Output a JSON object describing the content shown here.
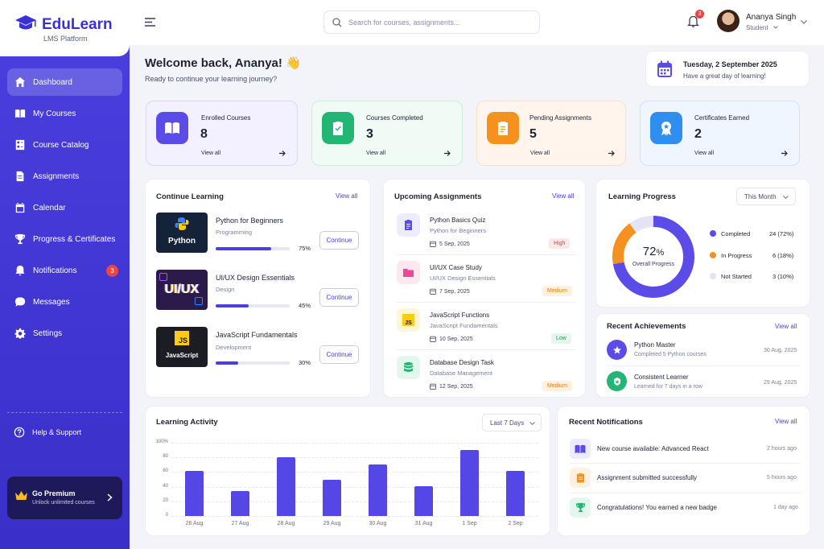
{
  "brand": {
    "name": "EduLearn",
    "sub": "LMS Platform"
  },
  "sidebar": {
    "items": [
      {
        "label": "Dashboard"
      },
      {
        "label": "My Courses"
      },
      {
        "label": "Course Catalog"
      },
      {
        "label": "Assignments"
      },
      {
        "label": "Calendar"
      },
      {
        "label": "Progress & Certificates"
      },
      {
        "label": "Notifications",
        "badge": "3"
      },
      {
        "label": "Messages"
      },
      {
        "label": "Settings"
      }
    ],
    "help": "Help & Support",
    "premium": {
      "title": "Go Premium",
      "sub": "Unlock unlimited courses"
    }
  },
  "topbar": {
    "search_placeholder": "Search for courses, assignments...",
    "notif_count": "3",
    "user_name": "Ananya Singh",
    "user_role": "Student"
  },
  "welcome": {
    "title": "Welcome back, Ananya! 👋",
    "sub": "Ready to continue your learning journey?"
  },
  "date": {
    "date": "Tuesday, 2 September 2025",
    "sub": "Have a great day of learning!"
  },
  "stats": [
    {
      "label": "Enrolled Courses",
      "value": "8",
      "link": "View all",
      "color": "#5b4ce8"
    },
    {
      "label": "Courses Completed",
      "value": "3",
      "link": "View all",
      "color": "#22b573"
    },
    {
      "label": "Pending Assignments",
      "value": "5",
      "link": "View all",
      "color": "#f5911e"
    },
    {
      "label": "Certificates Earned",
      "value": "2",
      "link": "View all",
      "color": "#2f8ff0"
    }
  ],
  "continue": {
    "title": "Continue Learning",
    "link": "View all",
    "courses": [
      {
        "name": "Python for Beginners",
        "cat": "Programming",
        "pct": "75%",
        "progress": 0.75,
        "thumb": "Python",
        "btn": "Continue"
      },
      {
        "name": "UI/UX Design Essentials",
        "cat": "Design",
        "pct": "45%",
        "progress": 0.45,
        "thumb": "UI/UX",
        "btn": "Continue"
      },
      {
        "name": "JavaScript Fundamentals",
        "cat": "Development",
        "pct": "30%",
        "progress": 0.3,
        "thumb": "JavaScript",
        "thumb_icon": "JS",
        "btn": "Continue"
      }
    ]
  },
  "assignments": {
    "title": "Upcoming Assignments",
    "link": "View all",
    "items": [
      {
        "name": "Python Basics Quiz",
        "course": "Python for Beginners",
        "date": "5 Sep, 2025",
        "priority": "High"
      },
      {
        "name": "UI/UX Case Study",
        "course": "UI/UX Design Essentials",
        "date": "7 Sep, 2025",
        "priority": "Medium"
      },
      {
        "name": "JavaScript Functions",
        "course": "JavaScript Fundamentals",
        "date": "10 Sep, 2025",
        "priority": "Low",
        "icon_text": "JS"
      },
      {
        "name": "Database Design Task",
        "course": "Database Management",
        "date": "12 Sep, 2025",
        "priority": "Medium"
      }
    ]
  },
  "progress": {
    "title": "Learning Progress",
    "filter": "This Month",
    "center_value": "72",
    "center_pct": "%",
    "center_label": "Overall Progress",
    "legend": [
      {
        "label": "Completed",
        "value": "24 (72%)",
        "color": "#5b4ce8",
        "fraction": 0.72
      },
      {
        "label": "In Progress",
        "value": "6 (18%)",
        "color": "#f5911e",
        "fraction": 0.18
      },
      {
        "label": "Not Started",
        "value": "3 (10%)",
        "color": "#e4e3f7",
        "fraction": 0.1
      }
    ]
  },
  "achievements": {
    "title": "Recent Achievements",
    "link": "View all",
    "items": [
      {
        "name": "Python Master",
        "desc": "Completed 5 Python courses",
        "date": "30 Aug, 2025"
      },
      {
        "name": "Consistent Learner",
        "desc": "Learned for 7 days in a row",
        "date": "29 Aug, 2025"
      }
    ]
  },
  "activity": {
    "title": "Learning Activity",
    "filter": "Last 7 Days"
  },
  "chart_data": {
    "type": "bar",
    "categories": [
      "26 Aug",
      "27 Aug",
      "28 Aug",
      "29 Aug",
      "30 Aug",
      "31 Aug",
      "1 Sep",
      "2 Sep"
    ],
    "values": [
      62,
      34,
      80,
      50,
      70,
      41,
      90,
      61
    ],
    "yticks": [
      "100%",
      "80",
      "60",
      "40",
      "20",
      "0"
    ],
    "ylim": [
      0,
      100
    ],
    "grid": true,
    "color": "#5546e6"
  },
  "notifications": {
    "title": "Recent Notifications",
    "link": "View all",
    "items": [
      {
        "text": "New course available: Advanced React",
        "time": "2 hours ago"
      },
      {
        "text": "Assignment submitted successfully",
        "time": "5 hours ago"
      },
      {
        "text": "Congratulations! You earned a new badge",
        "time": "1 day ago"
      }
    ]
  }
}
